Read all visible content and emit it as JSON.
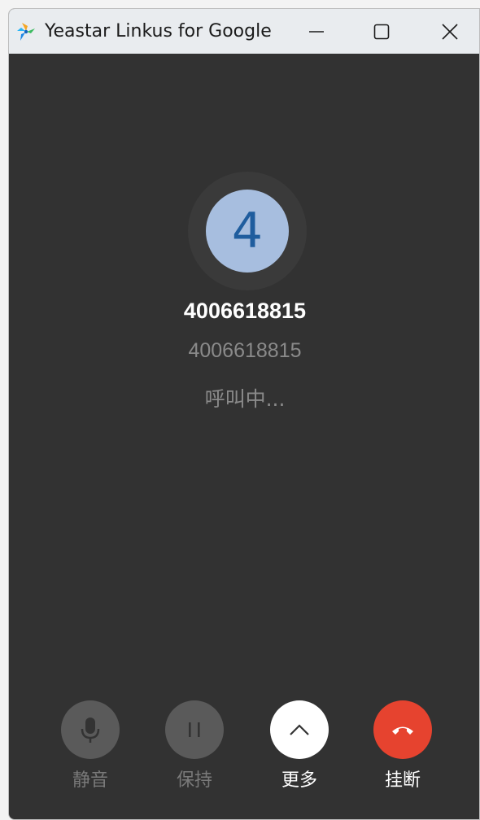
{
  "window": {
    "title": "Yeastar Linkus for Google",
    "icons": [
      "app-logo-icon",
      "minimize-icon",
      "maximize-icon",
      "close-icon"
    ]
  },
  "call": {
    "avatar_initial": "4",
    "name": "4006618815",
    "number": "4006618815",
    "status": "呼叫中..."
  },
  "actions": {
    "mute": {
      "label": "静音",
      "icon": "microphone-icon",
      "enabled": false
    },
    "hold": {
      "label": "保持",
      "icon": "pause-icon",
      "enabled": false
    },
    "more": {
      "label": "更多",
      "icon": "chevron-up-icon",
      "enabled": true
    },
    "hangup": {
      "label": "挂断",
      "icon": "hangup-phone-icon",
      "enabled": true
    }
  },
  "colors": {
    "background": "#323232",
    "titlebar": "#e9ecef",
    "avatar_bg": "#a7bedf",
    "avatar_text": "#1f5d9e",
    "hangup": "#e6432f",
    "disabled_button": "#5a5a5a"
  }
}
